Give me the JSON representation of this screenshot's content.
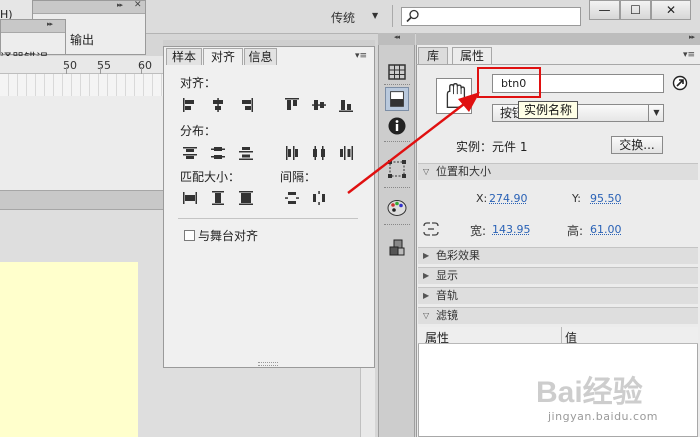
{
  "topbar": {
    "left_fragment": "H)",
    "workspace": "传统",
    "search": {
      "value": "",
      "placeholder": ""
    },
    "window_buttons": {
      "minimize": "—",
      "maximize": "☐",
      "close": "✕"
    }
  },
  "floating_panels": {
    "output_label": "输出",
    "compiler_errors_label": "译器错误"
  },
  "ruler": {
    "labels": [
      "50",
      "55",
      "60"
    ]
  },
  "align_panel": {
    "tabs": [
      "样本",
      "对齐",
      "信息"
    ],
    "active_tab": "对齐",
    "sections": {
      "align": "对齐：",
      "distribute": "分布：",
      "match_size": "匹配大小：",
      "spacing": "间隔："
    },
    "align_to_stage": "与舞台对齐"
  },
  "properties_panel": {
    "tabs": [
      "库",
      "属性"
    ],
    "active_tab": "属性",
    "instance_name": "btn0",
    "instance_type": "按钮",
    "tooltip": "实例名称",
    "instance_of": "实例：元件 1",
    "swap_button": "交换...",
    "sections": {
      "position_size": "位置和大小",
      "color_effect": "色彩效果",
      "display": "显示",
      "audio": "音轨",
      "filters": "滤镜"
    },
    "position": {
      "x_label": "X:",
      "x_value": "274.90",
      "y_label": "Y:",
      "y_value": "95.50",
      "w_label": "宽:",
      "w_value": "143.95",
      "h_label": "高:",
      "h_value": "61.00"
    },
    "filters_table": {
      "columns": [
        "属性",
        "值"
      ]
    }
  },
  "watermark": {
    "brand": "Bai经验",
    "url": "jingyan.baidu.com"
  },
  "colors": {
    "highlight": "#e01010",
    "stage": "#ffffcc",
    "value_link": "#2a62b6"
  }
}
